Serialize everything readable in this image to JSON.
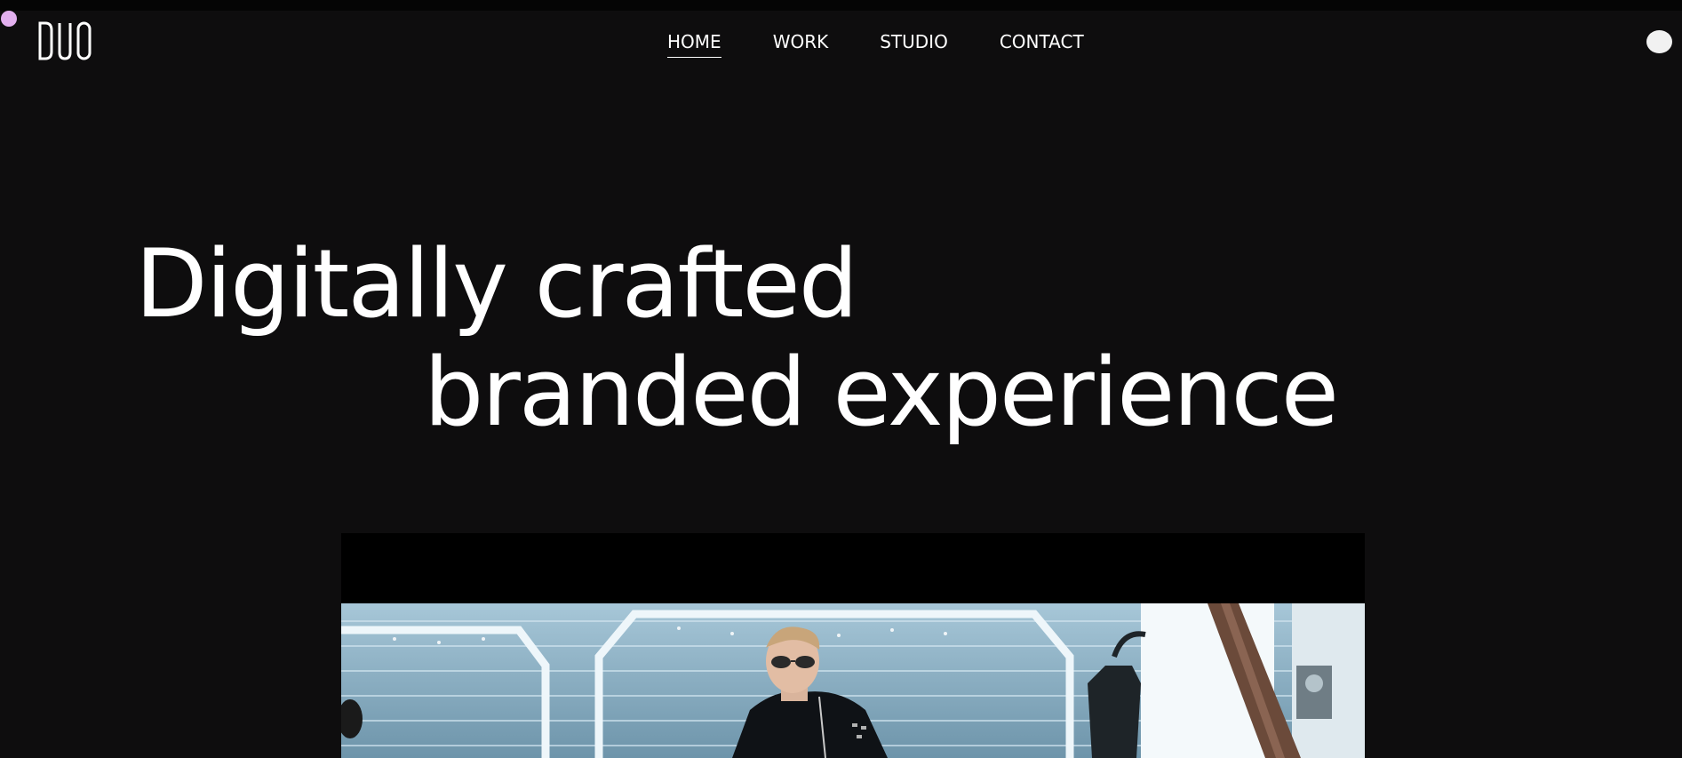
{
  "header": {
    "logo_text": "DUO",
    "nav": [
      {
        "label": "HOME",
        "active": true
      },
      {
        "label": "WORK",
        "active": false
      },
      {
        "label": "STUDIO",
        "active": false
      },
      {
        "label": "CONTACT",
        "active": false
      }
    ]
  },
  "hero": {
    "line1": "Digitally crafted",
    "line2": "branded experience"
  },
  "colors": {
    "background": "#0e0d0e",
    "text": "#ffffff",
    "cursor_dot": "#e3b0ef",
    "toggle": "#f1f1f1"
  },
  "icons": {
    "cursor": "cursor-dot-icon",
    "theme_toggle": "circle-toggle-icon"
  }
}
